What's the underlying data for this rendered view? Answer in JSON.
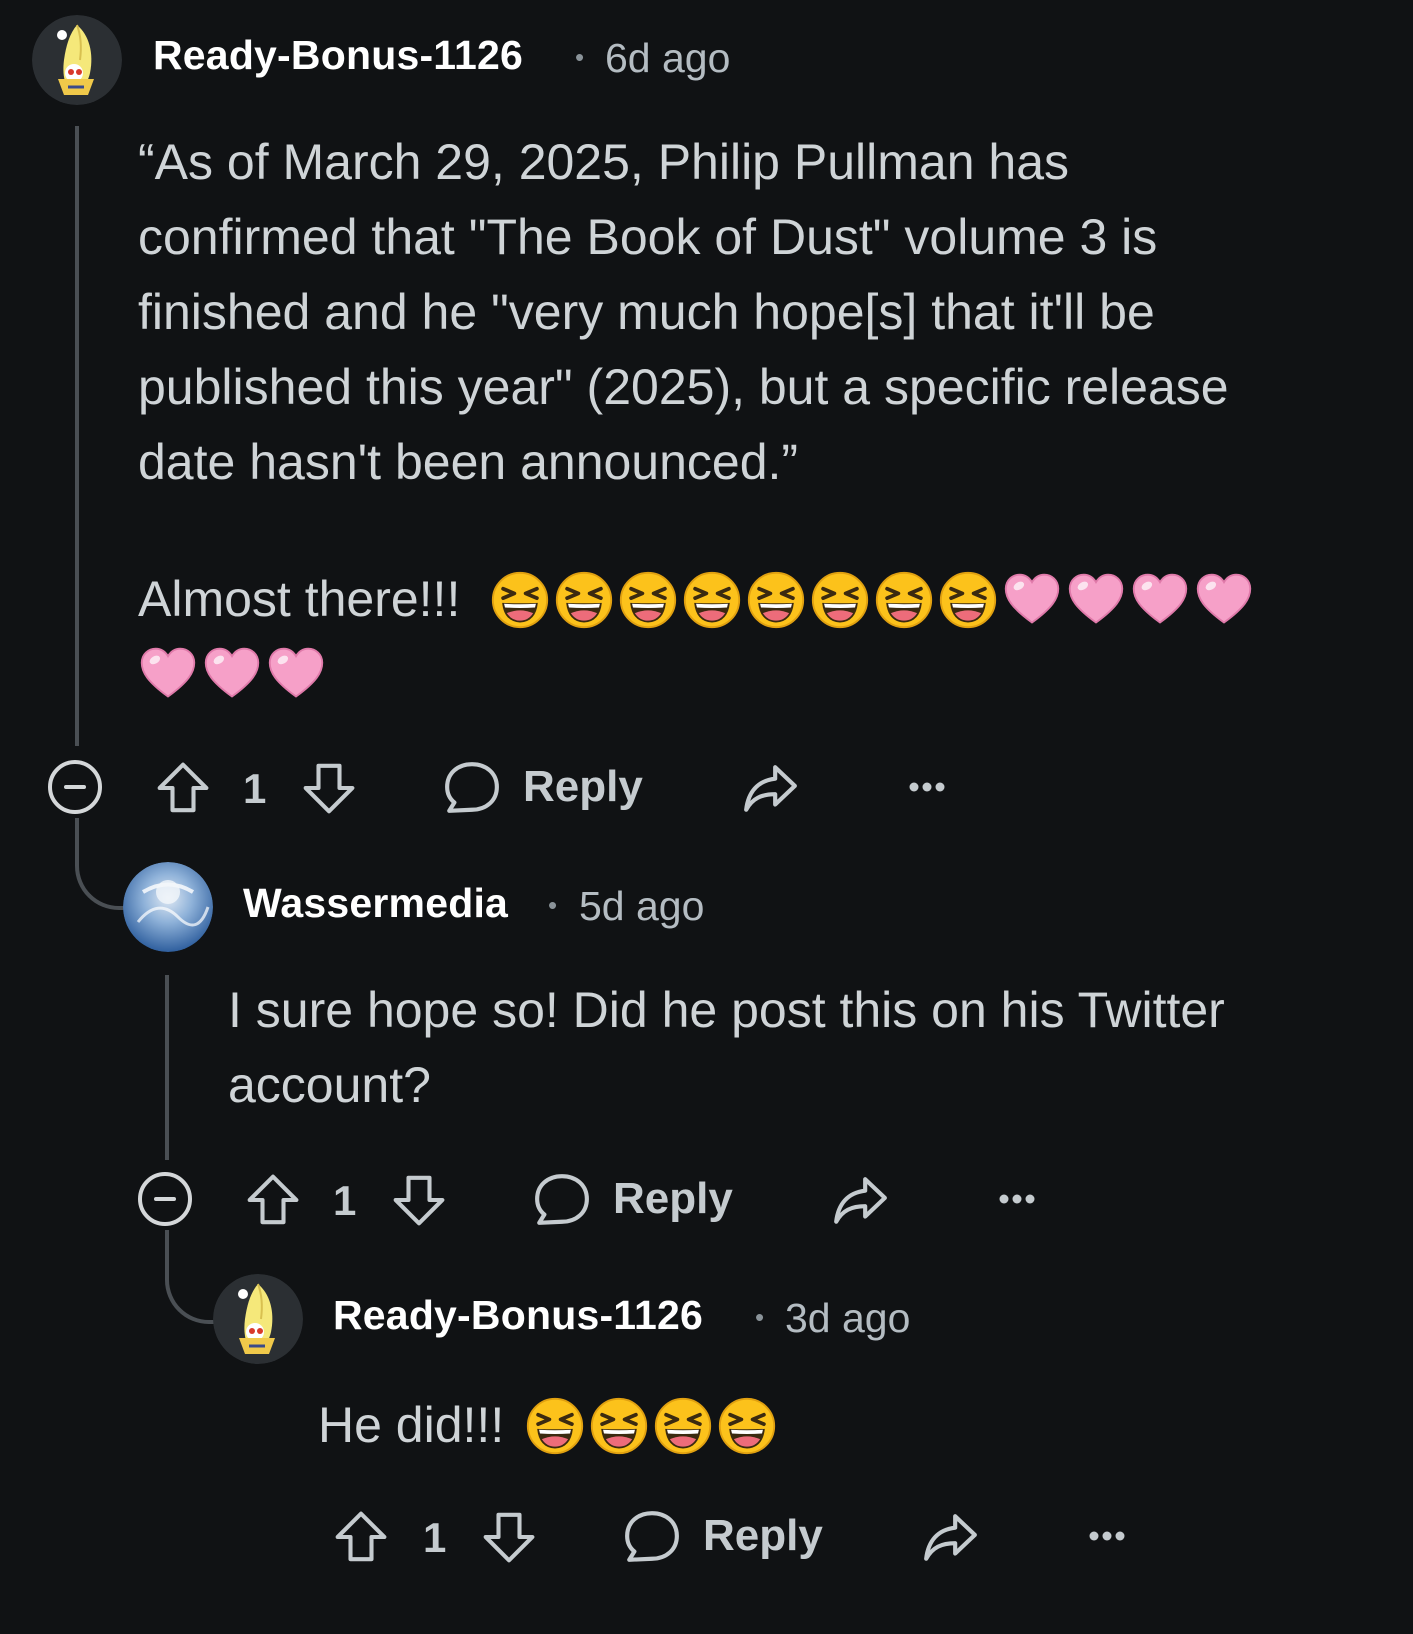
{
  "comments": [
    {
      "username": "Ready-Bonus-1126",
      "time": "6d ago",
      "text": "“As of March 29, 2025, Philip Pullman has confirmed that \"The Book of Dust\" volume 3 is finished and he \"very much hope[s] that it'll be published this year\" (2025), but a specific release date hasn't been announced.”",
      "text2": "Almost there!!!",
      "emoji_laugh_count": 8,
      "emoji_heart_count": 7,
      "votes": "1",
      "reply_label": "Reply"
    },
    {
      "username": "Wassermedia",
      "time": "5d ago",
      "text": "I sure hope so! Did he post this on his Twitter account?",
      "votes": "1",
      "reply_label": "Reply"
    },
    {
      "username": "Ready-Bonus-1126",
      "time": "3d ago",
      "text": "He did!!!",
      "emoji_laugh_count": 4,
      "votes": "1",
      "reply_label": "Reply"
    }
  ],
  "colors": {
    "background": "#101214",
    "thread_line": "#4a4f54",
    "username": "#ffffff",
    "text": "#cfd4d7",
    "heart": "#f6a0c8",
    "emoji_face": "#fcc21b"
  },
  "icons": [
    "upvote-icon",
    "downvote-icon",
    "comment-bubble-icon",
    "share-icon",
    "more-icon",
    "collapse-icon"
  ]
}
